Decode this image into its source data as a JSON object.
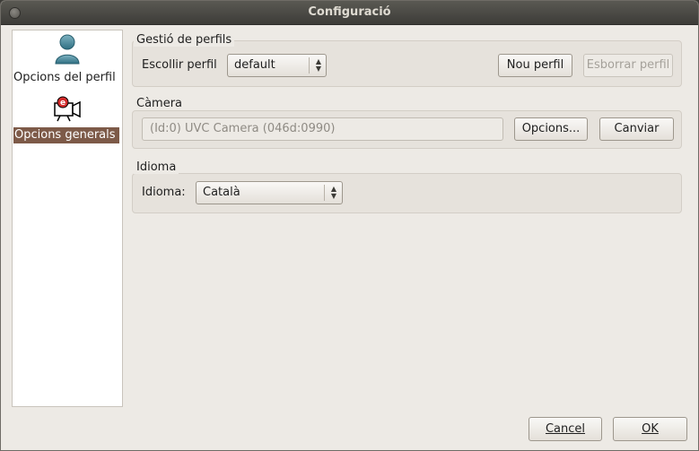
{
  "window": {
    "title": "Configuració"
  },
  "sidebar": {
    "items": [
      {
        "label": "Opcions del perfil",
        "icon": "user-profile-icon"
      },
      {
        "label": "Opcions generals",
        "icon": "camera-icon"
      }
    ]
  },
  "profiles": {
    "group_title": "Gestió de perfils",
    "choose_label": "Escollir perfil",
    "selected_profile": "default",
    "new_button": "Nou perfil",
    "delete_button": "Esborrar perfil"
  },
  "camera": {
    "group_title": "Càmera",
    "device": "(Id:0) UVC Camera (046d:0990)",
    "options_button": "Opcions...",
    "change_button": "Canviar"
  },
  "language": {
    "group_title": "Idioma",
    "label": "Idioma:",
    "selected": "Català"
  },
  "footer": {
    "cancel_button": "Cancel",
    "ok_button": "OK"
  },
  "colors": {
    "selection": "#7d5a48",
    "titlebar": "#3d3c38",
    "window_bg": "#edeae5"
  }
}
